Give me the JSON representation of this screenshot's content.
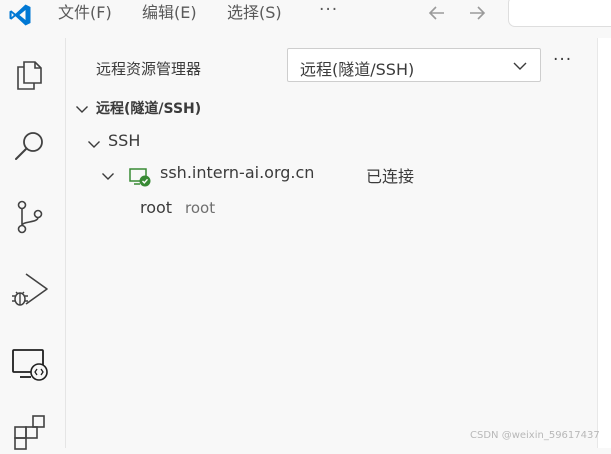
{
  "menu": {
    "file": "文件(F)",
    "edit": "编辑(E)",
    "selection": "选择(S)",
    "more": "···"
  },
  "sidebar": {
    "title": "远程资源管理器",
    "selector_value": "远程(隧道/SSH)",
    "more_actions": "···"
  },
  "tree": {
    "section": "远程(隧道/SSH)",
    "ssh_group": "SSH",
    "host": {
      "label": "ssh.intern-ai.org.cn",
      "status": "已连接"
    },
    "folder": {
      "label": "root",
      "description": "root"
    }
  },
  "watermark": "CSDN @weixin_59617437",
  "colors": {
    "accent": "#0078d4",
    "connected_green": "#388a34",
    "icon_gray": "#424242"
  }
}
